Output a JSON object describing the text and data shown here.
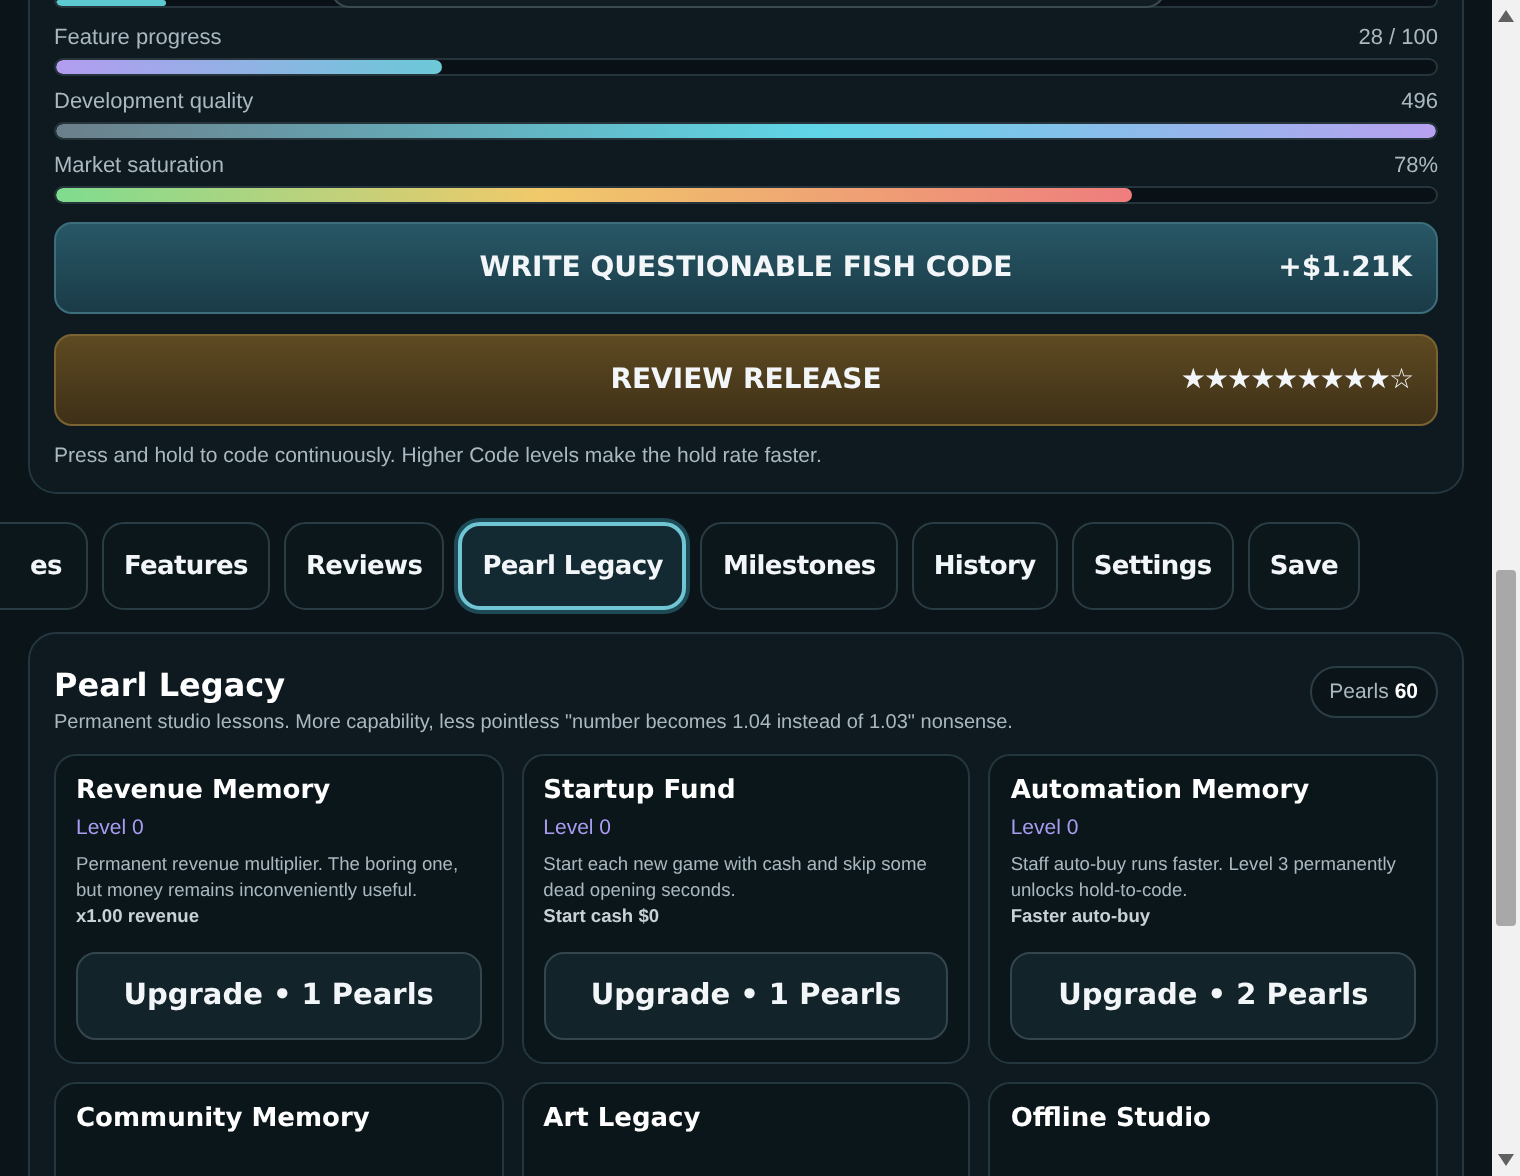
{
  "top_bar": {
    "level": 0.08
  },
  "meters": [
    {
      "label": "Feature progress",
      "reading": "28 / 100",
      "level": 0.28
    },
    {
      "label": "Development quality",
      "reading": "496",
      "level": 1
    },
    {
      "label": "Market saturation",
      "reading": "78%",
      "level": 0.78
    }
  ],
  "actions": [
    {
      "kind": "code",
      "label": "WRITE QUESTIONABLE FISH CODE",
      "value": "+$1.21K"
    },
    {
      "kind": "review",
      "label": "REVIEW RELEASE",
      "stars": 9
    }
  ],
  "hint": "Press and hold to code continuously. Higher Code levels make the hold rate faster.",
  "tabs": [
    {
      "label": "es",
      "selected": false
    },
    {
      "label": "Features",
      "selected": false
    },
    {
      "label": "Reviews",
      "selected": false
    },
    {
      "label": "Pearl Legacy",
      "selected": true
    },
    {
      "label": "Milestones",
      "selected": false
    },
    {
      "label": "History",
      "selected": false
    },
    {
      "label": "Settings",
      "selected": false
    },
    {
      "label": "Save",
      "selected": false
    }
  ],
  "legacy": {
    "title": "Pearl Legacy",
    "subtitle": "Permanent studio lessons. More capability, less pointless \"number becomes 1.04 instead of 1.03\" nonsense.",
    "pearls_label": "Pearls",
    "pearls": "60",
    "cards": [
      {
        "title": "Revenue Memory",
        "level": "Level 0",
        "description": "Permanent revenue multiplier. The boring one, but money remains inconveniently useful.",
        "effect": "x1.00 revenue",
        "button": "Upgrade • 1 Pearls"
      },
      {
        "title": "Startup Fund",
        "level": "Level 0",
        "description": "Start each new game with cash and skip some dead opening seconds.",
        "effect": "Start cash $0",
        "button": "Upgrade • 1 Pearls"
      },
      {
        "title": "Automation Memory",
        "level": "Level 0",
        "description": "Staff auto-buy runs faster. Level 3 permanently unlocks hold-to-code.",
        "effect": "Faster auto-buy",
        "button": "Upgrade • 2 Pearls"
      },
      {
        "title": "Community Memory"
      },
      {
        "title": "Art Legacy"
      },
      {
        "title": "Offline Studio"
      }
    ]
  }
}
